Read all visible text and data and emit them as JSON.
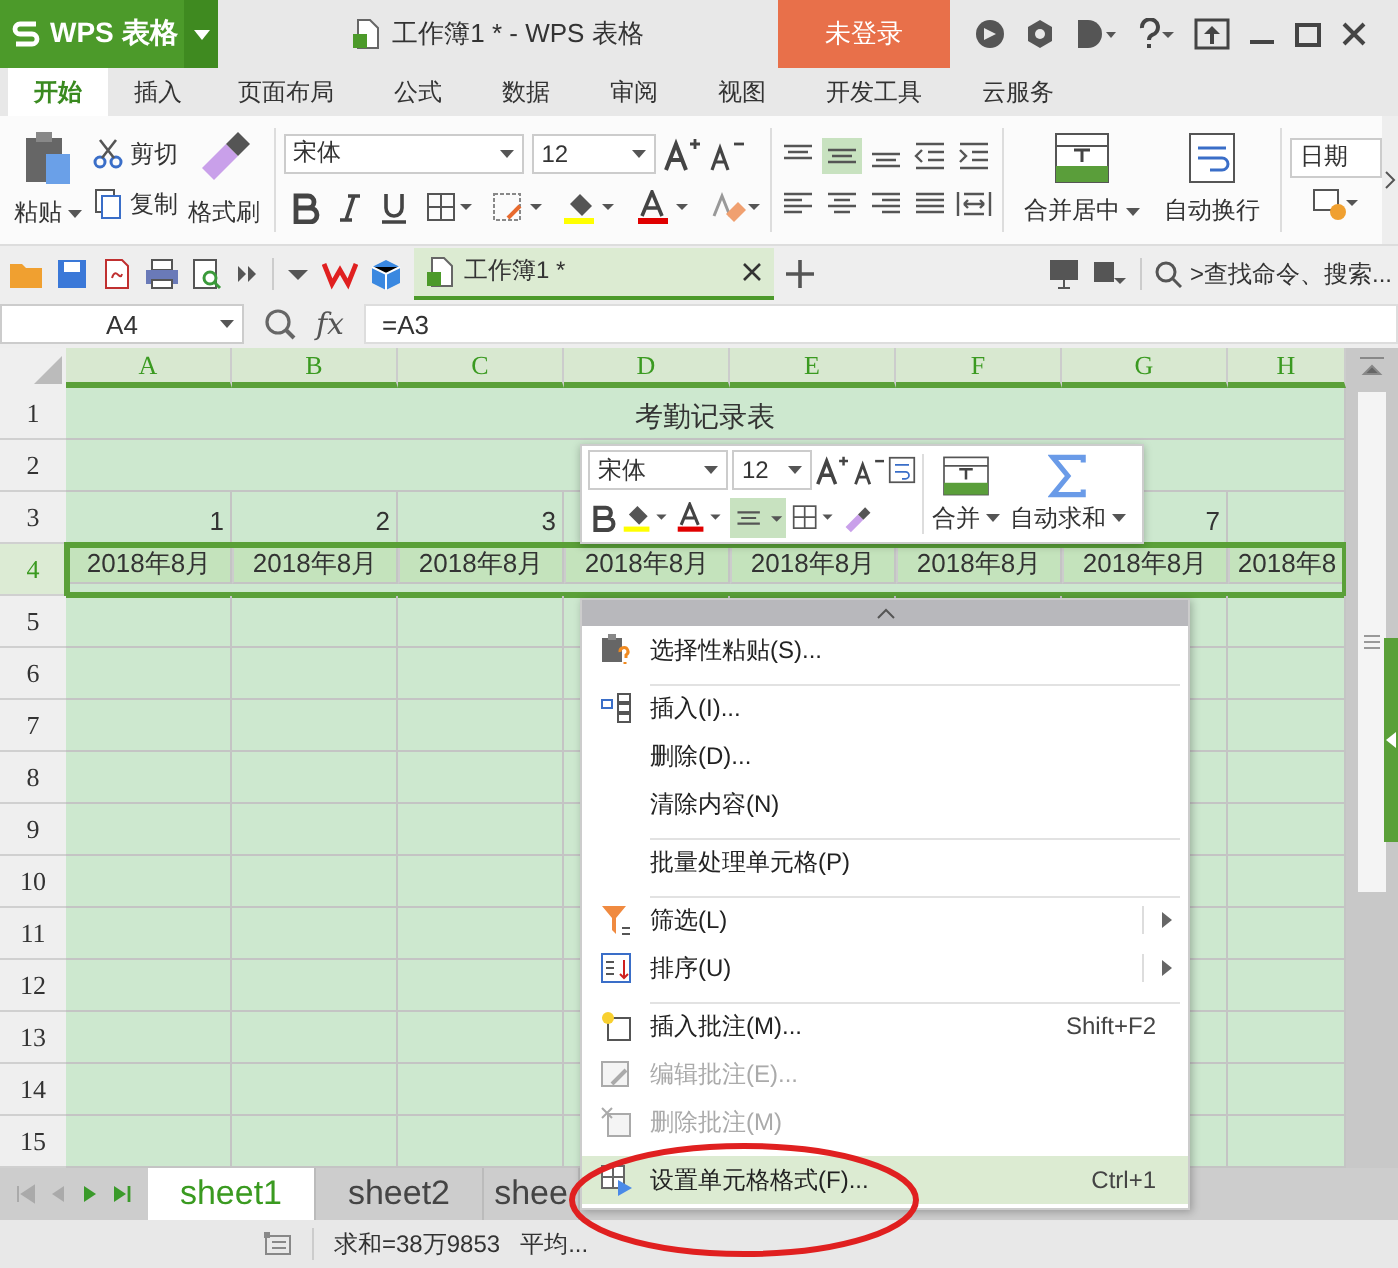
{
  "title_bar": {
    "app_name": "WPS 表格",
    "document_title": "工作簿1 * - WPS 表格",
    "login_button": "未登录"
  },
  "ribbon_tabs": [
    {
      "label": "开始",
      "selected": true
    },
    {
      "label": "插入",
      "selected": false
    },
    {
      "label": "页面布局",
      "selected": false
    },
    {
      "label": "公式",
      "selected": false
    },
    {
      "label": "数据",
      "selected": false
    },
    {
      "label": "审阅",
      "selected": false
    },
    {
      "label": "视图",
      "selected": false
    },
    {
      "label": "开发工具",
      "selected": false
    },
    {
      "label": "云服务",
      "selected": false
    }
  ],
  "ribbon": {
    "paste": "粘贴",
    "cut": "剪切",
    "copy": "复制",
    "format_painter": "格式刷",
    "font_name": "宋体",
    "font_size": "12",
    "center_align_on": true,
    "merge_center": "合并居中",
    "wrap_text": "自动换行",
    "number_format": "日期"
  },
  "quick_bar": {
    "document_tab": "工作簿1 *",
    "search_placeholder": ">查找命令、搜索..."
  },
  "formula_bar": {
    "name_box": "A4",
    "function_label": "fx",
    "formula": "=A3"
  },
  "sheet": {
    "columns": [
      {
        "label": "A",
        "selected": true
      },
      {
        "label": "B",
        "selected": true
      },
      {
        "label": "C",
        "selected": true
      },
      {
        "label": "D",
        "selected": true
      },
      {
        "label": "E",
        "selected": true
      },
      {
        "label": "F",
        "selected": true
      },
      {
        "label": "G",
        "selected": true
      },
      {
        "label": "H",
        "selected": true
      }
    ],
    "rows": [
      {
        "label": "1",
        "selected": false,
        "merged": true,
        "title": "考勤记录表"
      },
      {
        "label": "2",
        "selected": false,
        "merged": true
      },
      {
        "label": "3",
        "selected": false,
        "merged": false,
        "cells": [
          "1",
          "2",
          "3",
          null,
          null,
          null,
          "7",
          null
        ]
      },
      {
        "label": "4",
        "selected": true,
        "cells": [
          "2018年8月",
          "2018年8月",
          "2018年8月",
          "2018年8月",
          "2018年8月",
          "2018年8月",
          "2018年8月",
          "2018年8"
        ]
      },
      {
        "label": "5",
        "selected": false
      },
      {
        "label": "6",
        "selected": false
      },
      {
        "label": "7",
        "selected": false
      },
      {
        "label": "8",
        "selected": false
      },
      {
        "label": "9",
        "selected": false
      },
      {
        "label": "10",
        "selected": false
      },
      {
        "label": "11",
        "selected": false
      },
      {
        "label": "12",
        "selected": false
      },
      {
        "label": "13",
        "selected": false
      },
      {
        "label": "14",
        "selected": false
      },
      {
        "label": "15",
        "selected": false
      }
    ]
  },
  "sheet_tabs": [
    {
      "label": "sheet1",
      "selected": true
    },
    {
      "label": "sheet2",
      "selected": false
    },
    {
      "label": "shee",
      "selected": false
    }
  ],
  "status_bar": {
    "sum": "求和=38万9853",
    "average": "平均..."
  },
  "mini_toolbar": {
    "font_name": "宋体",
    "font_size": "12",
    "center_align_on": true,
    "merge": "合并",
    "autosum": "自动求和"
  },
  "context_menu": {
    "items": [
      {
        "label": "选择性粘贴(S)...",
        "separator_before": false,
        "submenu": false,
        "disabled": false,
        "selected": false
      },
      {
        "label": "插入(I)...",
        "separator_before": true,
        "submenu": false,
        "disabled": false,
        "selected": false
      },
      {
        "label": "删除(D)...",
        "separator_before": false,
        "submenu": false,
        "disabled": false,
        "selected": false
      },
      {
        "label": "清除内容(N)",
        "separator_before": false,
        "submenu": false,
        "disabled": false,
        "selected": false
      },
      {
        "label": "批量处理单元格(P)",
        "separator_before": true,
        "submenu": false,
        "disabled": false,
        "selected": false
      },
      {
        "label": "筛选(L)",
        "separator_before": true,
        "submenu": true,
        "disabled": false,
        "selected": false
      },
      {
        "label": "排序(U)",
        "separator_before": false,
        "submenu": true,
        "disabled": false,
        "selected": false
      },
      {
        "label": "插入批注(M)...",
        "shortcut": "Shift+F2",
        "separator_before": true,
        "submenu": false,
        "disabled": false,
        "selected": false
      },
      {
        "label": "编辑批注(E)...",
        "separator_before": false,
        "submenu": false,
        "disabled": true,
        "selected": false
      },
      {
        "label": "删除批注(M)",
        "separator_before": false,
        "submenu": false,
        "disabled": true,
        "selected": false
      },
      {
        "label": "设置单元格格式(F)...",
        "shortcut": "Ctrl+1",
        "separator_before": true,
        "submenu": false,
        "disabled": false,
        "selected": true
      }
    ]
  }
}
